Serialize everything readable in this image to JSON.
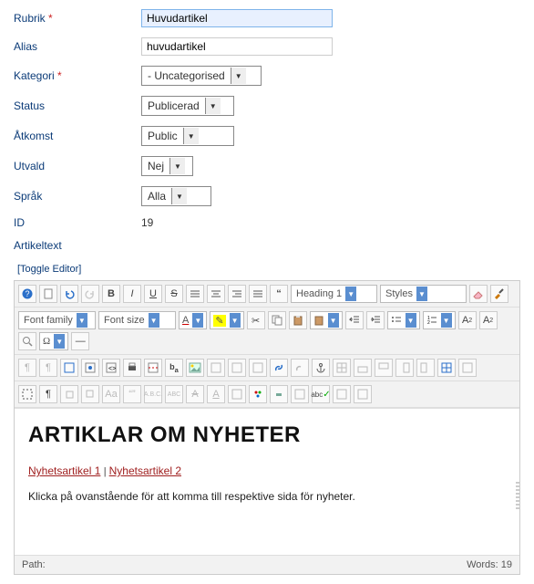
{
  "form": {
    "rubrik": {
      "label": "Rubrik",
      "required": "*",
      "value": "Huvudartikel"
    },
    "alias": {
      "label": "Alias",
      "value": "huvudartikel"
    },
    "kategori": {
      "label": "Kategori",
      "required": "*",
      "value": "- Uncategorised"
    },
    "status": {
      "label": "Status",
      "value": "Publicerad"
    },
    "atkomst": {
      "label": "Åtkomst",
      "value": "Public"
    },
    "utvald": {
      "label": "Utvald",
      "value": "Nej"
    },
    "sprak": {
      "label": "Språk",
      "value": "Alla"
    },
    "id": {
      "label": "ID",
      "value": "19"
    },
    "artikeltext": {
      "label": "Artikeltext"
    }
  },
  "toggle_editor": "[Toggle Editor]",
  "toolbar": {
    "heading": "Heading 1",
    "styles": "Styles",
    "font_family": "Font family",
    "font_size": "Font size",
    "bold": "B",
    "italic": "I",
    "underline": "U",
    "strike": "S"
  },
  "content": {
    "heading": "ARTIKLAR OM NYHETER",
    "link1": "Nyhetsartikel 1",
    "link_sep": "  |  ",
    "link2": "Nyhetsartikel 2",
    "paragraph": "Klicka på ovanstående för att komma till respektive sida för nyheter."
  },
  "statusbar": {
    "path_label": "Path:",
    "words_label": "Words: 19"
  }
}
